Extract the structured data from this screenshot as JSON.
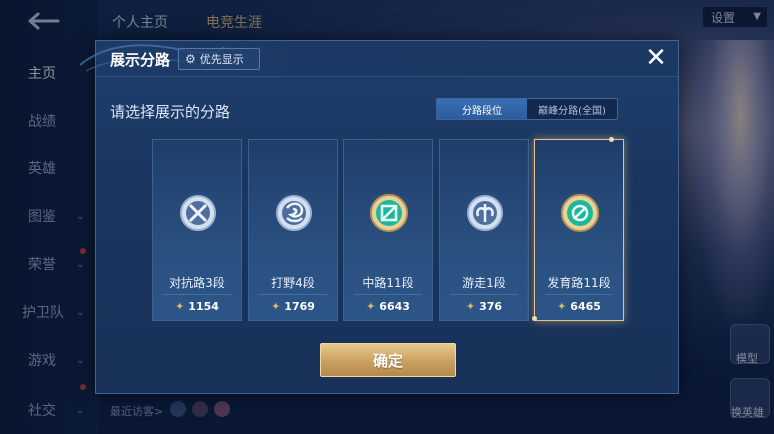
{
  "background": {
    "sidebar_items": [
      {
        "label": "主页",
        "active": true,
        "has_chevron": false
      },
      {
        "label": "战绩",
        "active": false,
        "has_chevron": false
      },
      {
        "label": "英雄",
        "active": false,
        "has_chevron": false
      },
      {
        "label": "图鉴",
        "active": false,
        "has_chevron": true
      },
      {
        "label": "荣誉",
        "active": false,
        "has_chevron": true
      },
      {
        "label": "护卫队",
        "active": false,
        "has_chevron": true
      },
      {
        "label": "游戏",
        "active": false,
        "has_chevron": true
      },
      {
        "label": "社交",
        "active": false,
        "has_chevron": true
      }
    ],
    "tabs": [
      "个人主页",
      "电竞生涯"
    ],
    "settings_label": "设置",
    "recent_visitors_label": "最近访客>",
    "bottom_right_labels": [
      "模型",
      "换英雄"
    ]
  },
  "modal": {
    "title": "展示分路",
    "priority_button_label": "优先显示",
    "close_symbol": "✕",
    "prompt": "请选择展示的分路",
    "toggle": {
      "options": [
        "分路段位",
        "巅峰分路(全国)"
      ],
      "selected_index": 0
    },
    "cards": [
      {
        "label": "对抗路3段",
        "score": "1154",
        "selected": false,
        "icon": "clash-lane-emblem-icon"
      },
      {
        "label": "打野4段",
        "score": "1769",
        "selected": false,
        "icon": "jungle-emblem-icon"
      },
      {
        "label": "中路11段",
        "score": "6643",
        "selected": false,
        "icon": "mid-lane-emblem-icon"
      },
      {
        "label": "游走1段",
        "score": "376",
        "selected": false,
        "icon": "roam-emblem-icon"
      },
      {
        "label": "发育路11段",
        "score": "6465",
        "selected": true,
        "icon": "farm-lane-emblem-icon"
      }
    ],
    "confirm_label": "确定"
  },
  "colors": {
    "gold_accent": "#caa061",
    "selected_border": "#e6c18a",
    "toggle_active": "#3a6fb3",
    "emerald_badge": "#1fb79a",
    "silver_badge": "#c9d6ea"
  }
}
